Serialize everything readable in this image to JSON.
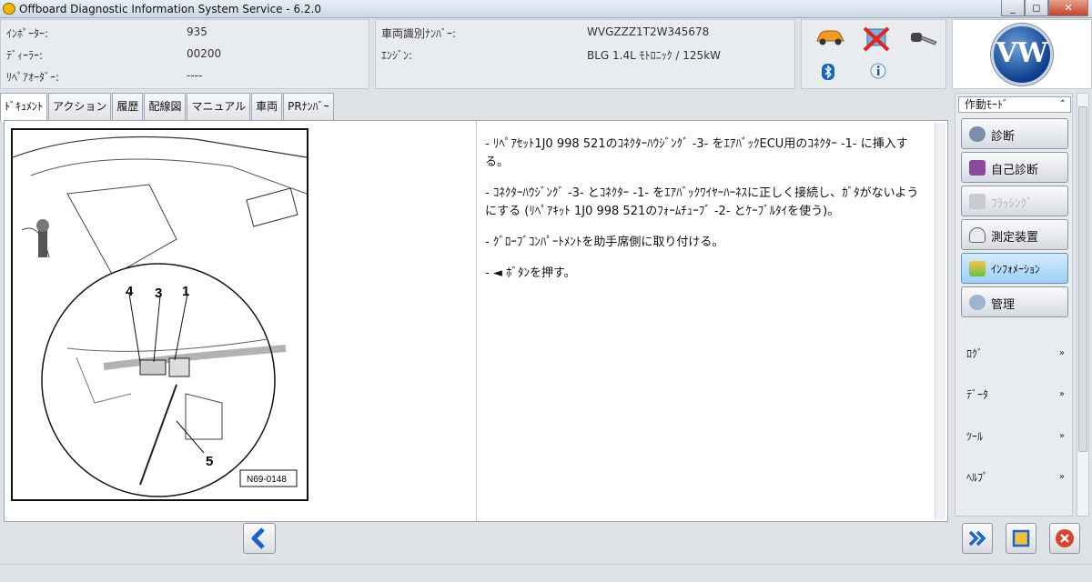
{
  "window": {
    "title": "Offboard Diagnostic Information System Service - 6.2.0"
  },
  "info": {
    "importer_label": "ｲﾝﾎﾟｰﾀｰ:",
    "importer_value": "935",
    "dealer_label": "ﾃﾞｨｰﾗｰ:",
    "dealer_value": "00200",
    "repair_order_label": "ﾘﾍﾟｱｵｰﾀﾞｰ:",
    "repair_order_value": "----",
    "vin_label": "車両識別ﾅﾝﾊﾞｰ:",
    "vin_value": "WVGZZZ1T2W345678",
    "engine_label": "ｴﾝｼﾞﾝ:",
    "engine_value": "BLG 1.4L ﾓﾄﾛﾆｯｸ / 125kW",
    "brand_logo": "VW"
  },
  "tabs": [
    {
      "label": "ﾄﾞｷｭﾒﾝﾄ"
    },
    {
      "label": "アクション"
    },
    {
      "label": "履歴"
    },
    {
      "label": "配線図"
    },
    {
      "label": "マニュアル"
    },
    {
      "label": "車両"
    },
    {
      "label": "PRﾅﾝﾊﾞｰ"
    }
  ],
  "figure": {
    "labels": [
      "4",
      "3",
      "1",
      "5"
    ],
    "code": "N69-0148"
  },
  "instructions": [
    "- ﾘﾍﾟｱｾｯﾄ1J0 998 521のｺﾈｸﾀｰﾊｳｼﾞﾝｸﾞ -3- をｴｱﾊﾞｯｸECU用のｺﾈｸﾀｰ -1- に挿入する。",
    "- ｺﾈｸﾀｰﾊｳｼﾞﾝｸﾞ -3- とｺﾈｸﾀｰ -1- をｴｱﾊﾞｯｸﾜｲﾔｰﾊｰﾈｽに正しく接続し、ｶﾞﾀがないようにする (ﾘﾍﾟｱｷｯﾄ 1J0 998 521のﾌｫｰﾑﾁｭｰﾌﾞ -2- とｹｰﾌﾞﾙﾀｲを使う)。",
    "- ｸﾞﾛｰﾌﾞｺﾝﾊﾟｰﾄﾒﾝﾄを助手席側に取り付ける。",
    "- ◄ ﾎﾞﾀﾝを押す。"
  ],
  "mode_panel": {
    "header": "作動ﾓｰﾄﾞ",
    "buttons": [
      {
        "label": "診断",
        "icon": "stethoscope-icon",
        "state": "normal"
      },
      {
        "label": "自己診断",
        "icon": "book-icon",
        "state": "normal"
      },
      {
        "label": "ﾌﾗｯｼﾝｸﾞ",
        "icon": "flash-icon",
        "state": "disabled"
      },
      {
        "label": "測定装置",
        "icon": "gauge-icon",
        "state": "normal"
      },
      {
        "label": "ｲﾝﾌｫﾒｰｼｮﾝ",
        "icon": "info-stack-icon",
        "state": "active"
      },
      {
        "label": "管理",
        "icon": "gear-icon",
        "state": "normal"
      }
    ],
    "sections": [
      "ﾛｸﾞ",
      "ﾃﾞｰﾀ",
      "ﾂｰﾙ",
      "ﾍﾙﾌﾟ"
    ]
  },
  "colors": {
    "accent_blue": "#1e63c9",
    "active_button": "#b8defa",
    "close_red": "#d8432c"
  }
}
